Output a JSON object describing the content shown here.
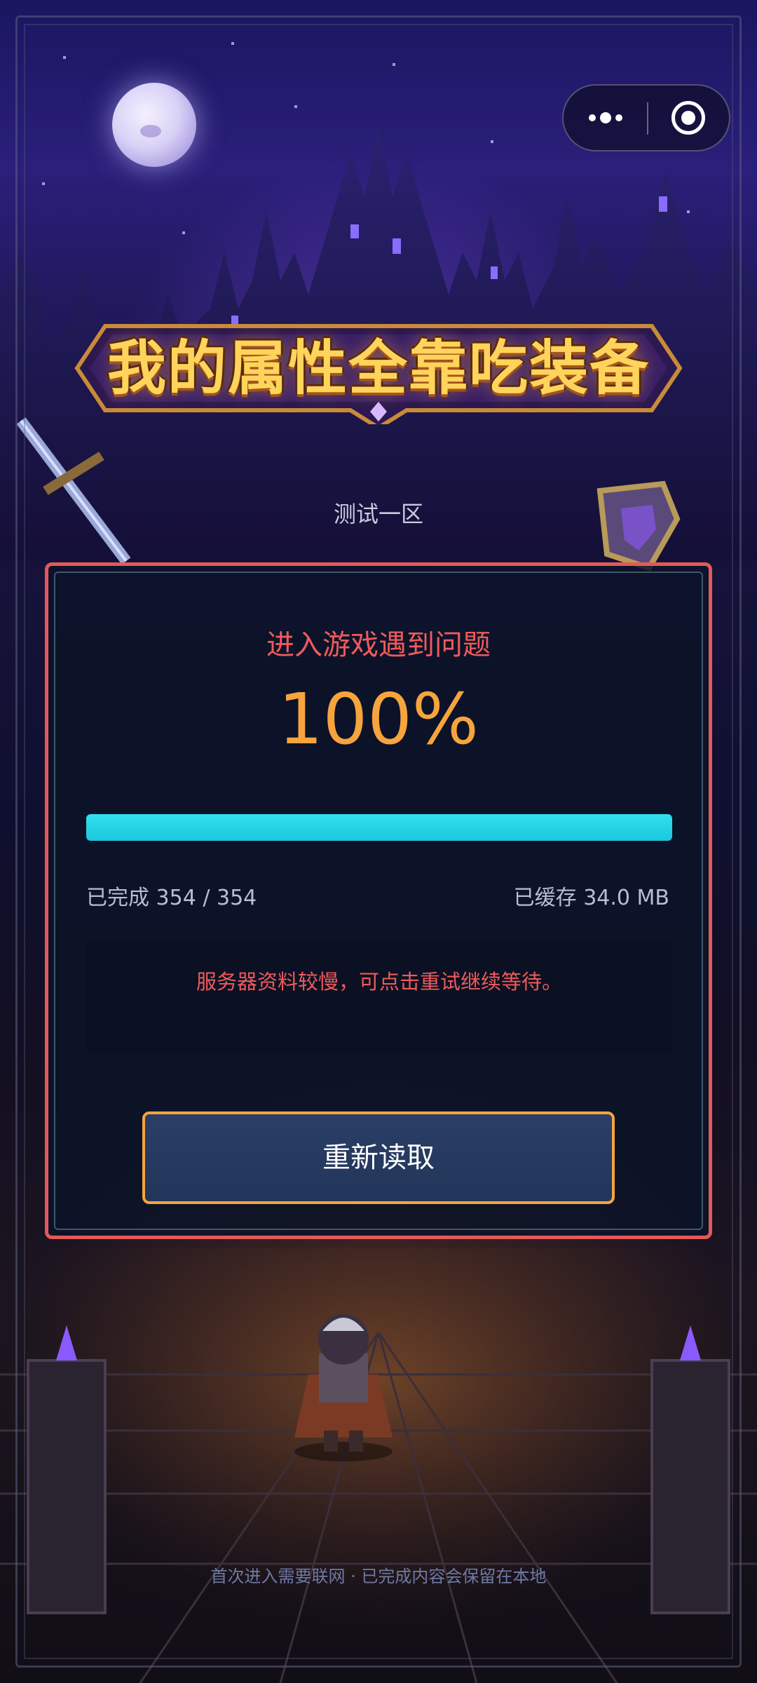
{
  "game": {
    "title": "我的属性全靠吃装备",
    "server": "测试一区"
  },
  "capsule": {
    "more_icon": "more-dots-icon",
    "close_icon": "close-target-icon"
  },
  "loader": {
    "title": "进入游戏遇到问题",
    "percent_text": "100%",
    "progress": 1.0,
    "completed_text": "已完成 354 / 354",
    "cached_text": "已缓存 34.0 MB",
    "message": "服务器资料较慢，可点击重试继续等待。",
    "retry_label": "重新读取"
  },
  "footer": {
    "note": "首次进入需要联网 · 已完成内容会保留在本地"
  },
  "colors": {
    "error_red": "#e5585a",
    "accent_orange": "#f6a43d",
    "progress_cyan": "#1cc7dc",
    "card_bg": "#0c1428",
    "title_gold": "#ffd45c"
  }
}
